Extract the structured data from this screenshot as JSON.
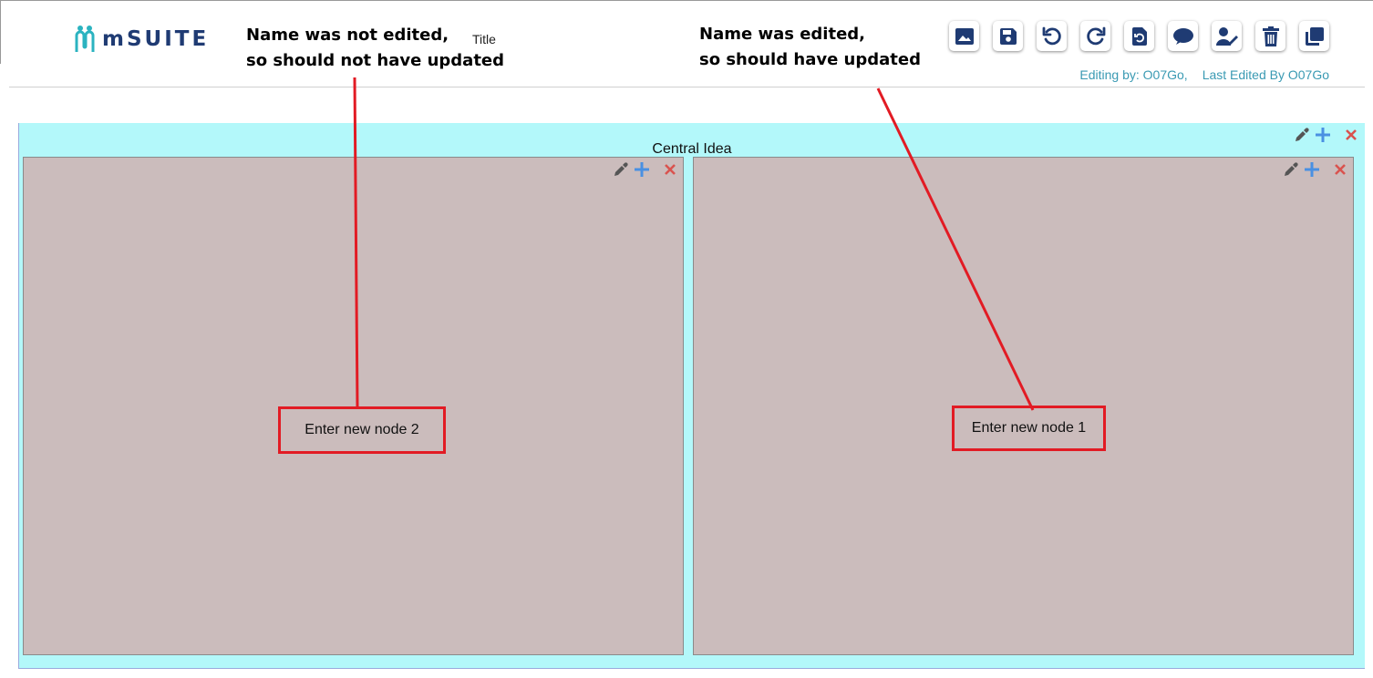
{
  "header": {
    "logo_text": "mSUITE",
    "title_field": "Title",
    "toolbar": [
      {
        "icon": "image-icon",
        "name": "export-image-button"
      },
      {
        "icon": "save-icon",
        "name": "save-button"
      },
      {
        "icon": "undo-icon",
        "name": "undo-button"
      },
      {
        "icon": "redo-icon",
        "name": "redo-button"
      },
      {
        "icon": "reload-icon",
        "name": "reload-button"
      },
      {
        "icon": "comment-icon",
        "name": "comment-button"
      },
      {
        "icon": "user-edit-icon",
        "name": "edit-user-button"
      },
      {
        "icon": "trash-icon",
        "name": "delete-button"
      },
      {
        "icon": "copy-icon",
        "name": "copy-button"
      }
    ],
    "editing_by": "Editing by: O07Go,",
    "last_edited_by": "Last Edited By O07Go"
  },
  "annotations": {
    "left": [
      "Name was not edited,",
      "so should not have updated"
    ],
    "right": [
      "Name was edited,",
      "so should have updated"
    ]
  },
  "mindmap": {
    "central": {
      "label": "Central Idea",
      "color": "#b3f8fa"
    },
    "nodes": [
      {
        "label": "Enter new node 2",
        "color": "#cbbcbc"
      },
      {
        "label": "Enter new node 1",
        "color": "#cbbcbc"
      }
    ]
  },
  "colors": {
    "brand_dark": "#1f3b73",
    "brand_teal": "#2bb3c0",
    "editing_text": "#3a9ab3",
    "annotation_red": "#e21b24",
    "add_blue": "#4a90e2",
    "delete_red": "#d9534f"
  }
}
